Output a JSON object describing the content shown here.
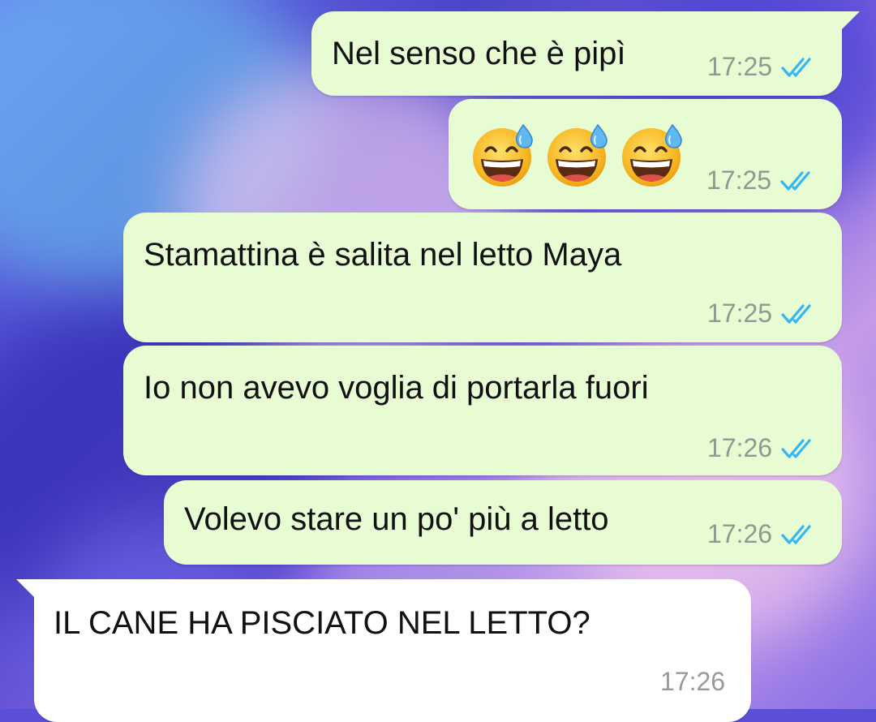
{
  "colors": {
    "outgoing_bubble": "#e8fcd4",
    "incoming_bubble": "#ffffff",
    "read_ticks": "#34b7f1"
  },
  "messages": [
    {
      "direction": "outgoing",
      "text": "Nel senso che è pipì",
      "time": "17:25",
      "status": "read",
      "status_icon": "double-check-icon"
    },
    {
      "direction": "outgoing",
      "emoji": [
        "😅",
        "😅",
        "😅"
      ],
      "emoji_name": "grinning-face-with-sweat",
      "time": "17:25",
      "status": "read",
      "status_icon": "double-check-icon"
    },
    {
      "direction": "outgoing",
      "text": "Stamattina è salita nel letto Maya",
      "time": "17:25",
      "status": "read",
      "status_icon": "double-check-icon"
    },
    {
      "direction": "outgoing",
      "text": "Io non avevo voglia di portarla fuori",
      "time": "17:26",
      "status": "read",
      "status_icon": "double-check-icon"
    },
    {
      "direction": "outgoing",
      "text": "Volevo stare un po' più a letto",
      "time": "17:26",
      "status": "read",
      "status_icon": "double-check-icon"
    },
    {
      "direction": "incoming",
      "text": "IL CANE HA PISCIATO NEL LETTO?",
      "time": "17:26"
    }
  ]
}
